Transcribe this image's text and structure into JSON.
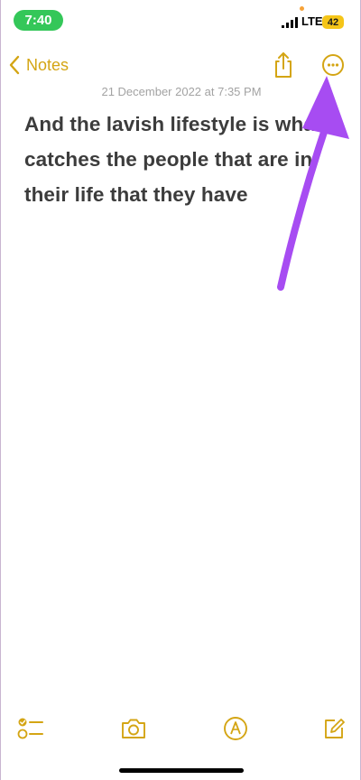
{
  "status_bar": {
    "time": "7:40",
    "network": "LTE",
    "battery": "42"
  },
  "nav": {
    "back_label": "Notes",
    "icons": [
      "chevron-left-icon",
      "share-icon",
      "more-icon"
    ]
  },
  "note": {
    "date": "21 December 2022 at 7:35 PM",
    "text": "And the lavish lifestyle is what catches the people that are in their life that they have"
  },
  "toolbar": {
    "icons": [
      "checklist-icon",
      "camera-icon",
      "markup-icon",
      "compose-icon"
    ]
  },
  "colors": {
    "accent": "#d4a514",
    "status_green": "#34c759",
    "battery_yellow": "#f5c518",
    "annotation_arrow": "#a74cf2",
    "note_text": "#3c3c3c",
    "date_text": "#a3a3a3"
  }
}
